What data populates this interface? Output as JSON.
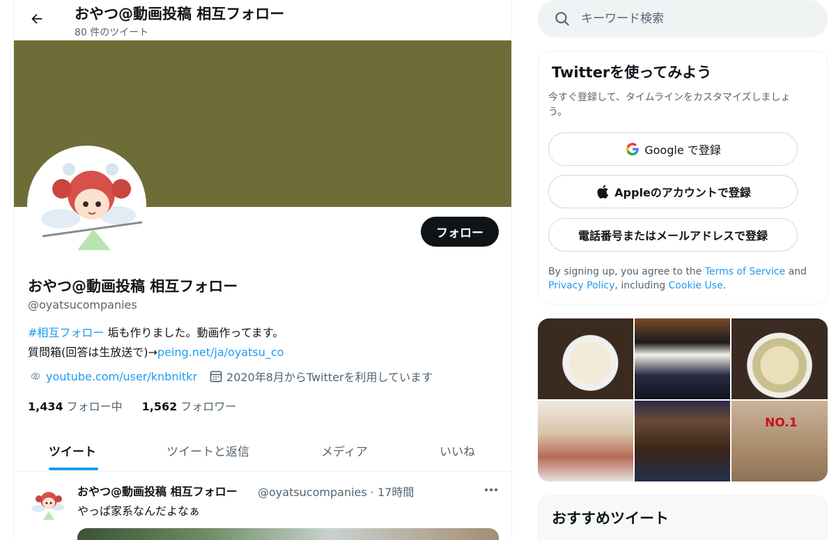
{
  "header": {
    "title": "おやつ@動画投稿 相互フォロー",
    "tweet_count": "80 件のツイート"
  },
  "profile": {
    "name": "おやつ@動画投稿 相互フォロー",
    "handle": "@oyatsucompanies",
    "follow_label": "フォロー",
    "bio_hashtag": "#相互フォロー",
    "bio_text1": " 垢も作りました。動画作ってます。",
    "bio_text2": " 質問箱(回答は生放送で)→",
    "bio_link": "peing.net/ja/oyatsu_co",
    "website": "youtube.com/user/knbnitkr",
    "joined": "2020年8月からTwitterを利用しています",
    "following_count": "1,434",
    "following_label": "フォロー中",
    "followers_count": "1,562",
    "followers_label": "フォロワー",
    "banner_color": "#6e6d38"
  },
  "tabs": [
    {
      "label": "ツイート"
    },
    {
      "label": "ツイートと返信"
    },
    {
      "label": "メディア"
    },
    {
      "label": "いいね"
    }
  ],
  "tweet": {
    "name": "おやつ@動画投稿 相互フォロー",
    "handle_time": "@oyatsucompanies · 17時間",
    "text": "やっぱ家系なんだよなぁ"
  },
  "search": {
    "placeholder": "キーワード検索"
  },
  "signup": {
    "title": "Twitterを使ってみよう",
    "subtitle": "今すぐ登録して、タイムラインをカスタマイズしましょう。",
    "google_label": "Google で登録",
    "apple_label": "Appleのアカウントで登録",
    "phone_label": "電話番号またはメールアドレスで登録",
    "terms_prefix": "By signing up, you agree to the ",
    "terms_link": "Terms of Service",
    "terms_and": " and ",
    "privacy_link": "Privacy Policy",
    "terms_including": ", including ",
    "cookie_link": "Cookie Use",
    "terms_end": "."
  },
  "photos": {
    "box_label": "NO.1"
  },
  "recommended": {
    "title": "おすすめツイート"
  },
  "colors": {
    "accent": "#1d9bf0",
    "text": "#0f1419",
    "muted": "#536471"
  }
}
